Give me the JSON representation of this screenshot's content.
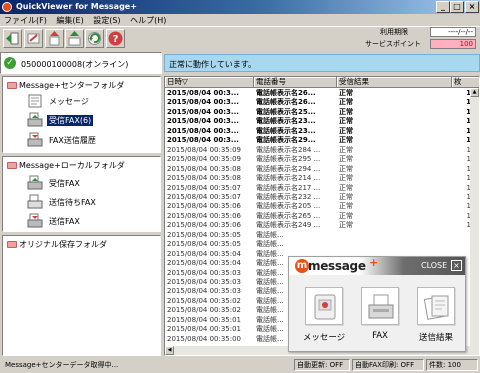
{
  "window": {
    "title": "QuickViewer for Message+",
    "buttons": [
      "_",
      "□",
      "×"
    ]
  },
  "menu": {
    "items": [
      "ファイル(F)",
      "編集(E)",
      "設定(S)",
      "ヘルプ(H)"
    ]
  },
  "toolbar": {
    "buttons": [
      {
        "icon": "exit-icon",
        "color": "#2e8b3a"
      },
      {
        "icon": "receive-icon",
        "color": "#c04040"
      },
      {
        "icon": "upload-icon",
        "color": "#d04040"
      },
      {
        "icon": "send-icon",
        "color": "#2e8b3a"
      },
      {
        "icon": "refresh-icon",
        "color": "#2e8b3a"
      },
      {
        "icon": "help-icon",
        "color": "#d04040"
      }
    ],
    "usage_label": "利用期限",
    "usage_value": "----/--/--",
    "points_label": "サービスポイント",
    "points_value": "100"
  },
  "status": {
    "online": "050000100008(オンライン)",
    "message": "正常に動作しています。"
  },
  "folders": {
    "center": {
      "title": "Message+センターフォルダ",
      "items": [
        {
          "label": "メッセージ",
          "icon": "message-icon"
        },
        {
          "label": "受信FAX(6)",
          "icon": "fax-receive-icon",
          "selected": true
        },
        {
          "label": "FAX送信履歴",
          "icon": "fax-history-icon"
        }
      ]
    },
    "local": {
      "title": "Message+ローカルフォルダ",
      "items": [
        {
          "label": "受信FAX",
          "icon": "fax-receive-icon"
        },
        {
          "label": "送信待ちFAX",
          "icon": "fax-pending-icon"
        },
        {
          "label": "送信FAX",
          "icon": "fax-sent-icon"
        }
      ]
    },
    "original": {
      "title": "オリジナル保存フォルダ"
    }
  },
  "grid": {
    "columns": [
      "日時▽",
      "電話番号",
      "受信結果",
      "枚"
    ],
    "rows": [
      {
        "datetime": "2015/08/04 00:3...",
        "phone": "電話帳表示名26...",
        "result": "正常",
        "pages": "1",
        "unread": true
      },
      {
        "datetime": "2015/08/04 00:3...",
        "phone": "電話帳表示名26...",
        "result": "正常",
        "pages": "1",
        "unread": true
      },
      {
        "datetime": "2015/08/04 00:3...",
        "phone": "電話帳表示名25...",
        "result": "正常",
        "pages": "1",
        "unread": true
      },
      {
        "datetime": "2015/08/04 00:3...",
        "phone": "電話帳表示名23...",
        "result": "正常",
        "pages": "1",
        "unread": true
      },
      {
        "datetime": "2015/08/04 00:3...",
        "phone": "電話帳表示名23...",
        "result": "正常",
        "pages": "1",
        "unread": true
      },
      {
        "datetime": "2015/08/04 00:3...",
        "phone": "電話帳表示名29...",
        "result": "正常",
        "pages": "1",
        "unread": true
      },
      {
        "datetime": "2015/08/04 00:35:09",
        "phone": "電話帳表示名284 ...",
        "result": "正常",
        "pages": "1"
      },
      {
        "datetime": "2015/08/04 00:35:09",
        "phone": "電話帳表示名295 ...",
        "result": "正常",
        "pages": "1"
      },
      {
        "datetime": "2015/08/04 00:35:08",
        "phone": "電話帳表示名294 ...",
        "result": "正常",
        "pages": "1"
      },
      {
        "datetime": "2015/08/04 00:35:08",
        "phone": "電話帳表示名214 ...",
        "result": "正常",
        "pages": "1"
      },
      {
        "datetime": "2015/08/04 00:35:07",
        "phone": "電話帳表示名217 ...",
        "result": "正常",
        "pages": "1"
      },
      {
        "datetime": "2015/08/04 00:35:07",
        "phone": "電話帳表示名232 ...",
        "result": "正常",
        "pages": "1"
      },
      {
        "datetime": "2015/08/04 00:35:06",
        "phone": "電話帳表示名205 ...",
        "result": "正常",
        "pages": "1"
      },
      {
        "datetime": "2015/08/04 00:35:06",
        "phone": "電話帳表示名265 ...",
        "result": "正常",
        "pages": "1"
      },
      {
        "datetime": "2015/08/04 00:35:06",
        "phone": "電話帳表示名249 ...",
        "result": "正常",
        "pages": "1"
      },
      {
        "datetime": "2015/08/04 00:35:05",
        "phone": "電話帳...",
        "result": "",
        "pages": ""
      },
      {
        "datetime": "2015/08/04 00:35:05",
        "phone": "電話帳...",
        "result": "",
        "pages": ""
      },
      {
        "datetime": "2015/08/04 00:35:04",
        "phone": "電話帳...",
        "result": "",
        "pages": ""
      },
      {
        "datetime": "2015/08/04 00:35:04",
        "phone": "電話帳...",
        "result": "",
        "pages": ""
      },
      {
        "datetime": "2015/08/04 00:35:03",
        "phone": "電話帳...",
        "result": "",
        "pages": ""
      },
      {
        "datetime": "2015/08/04 00:35:03",
        "phone": "電話帳...",
        "result": "",
        "pages": ""
      },
      {
        "datetime": "2015/08/04 00:35:03",
        "phone": "電話帳...",
        "result": "",
        "pages": ""
      },
      {
        "datetime": "2015/08/04 00:35:02",
        "phone": "電話帳...",
        "result": "",
        "pages": ""
      },
      {
        "datetime": "2015/08/04 00:35:02",
        "phone": "電話帳...",
        "result": "",
        "pages": ""
      },
      {
        "datetime": "2015/08/04 00:35:01",
        "phone": "電話帳...",
        "result": "",
        "pages": ""
      },
      {
        "datetime": "2015/08/04 00:35:01",
        "phone": "電話帳...",
        "result": "",
        "pages": ""
      },
      {
        "datetime": "2015/08/04 00:35:00",
        "phone": "電話帳...",
        "result": "",
        "pages": ""
      }
    ]
  },
  "popup": {
    "logo_mark": "m",
    "logo_text": "message",
    "logo_plus": "+",
    "close_label": "CLOSE",
    "close_icon": "×",
    "buttons": [
      {
        "label": "メッセージ",
        "icon": "message-icon"
      },
      {
        "label": "FAX",
        "icon": "fax-icon"
      },
      {
        "label": "送信結果",
        "icon": "send-result-icon"
      }
    ]
  },
  "statusbar": {
    "message": "Message+センターデータ取得中...",
    "auto_update": "自動更新: OFF",
    "auto_print": "自動FAX印刷: OFF",
    "count": "件数: 100"
  },
  "colors": {
    "selection": "#0a246a",
    "status_panel": "#a8d8f0",
    "points_bg": "#ffb0c0",
    "brand": "#e8501a"
  }
}
